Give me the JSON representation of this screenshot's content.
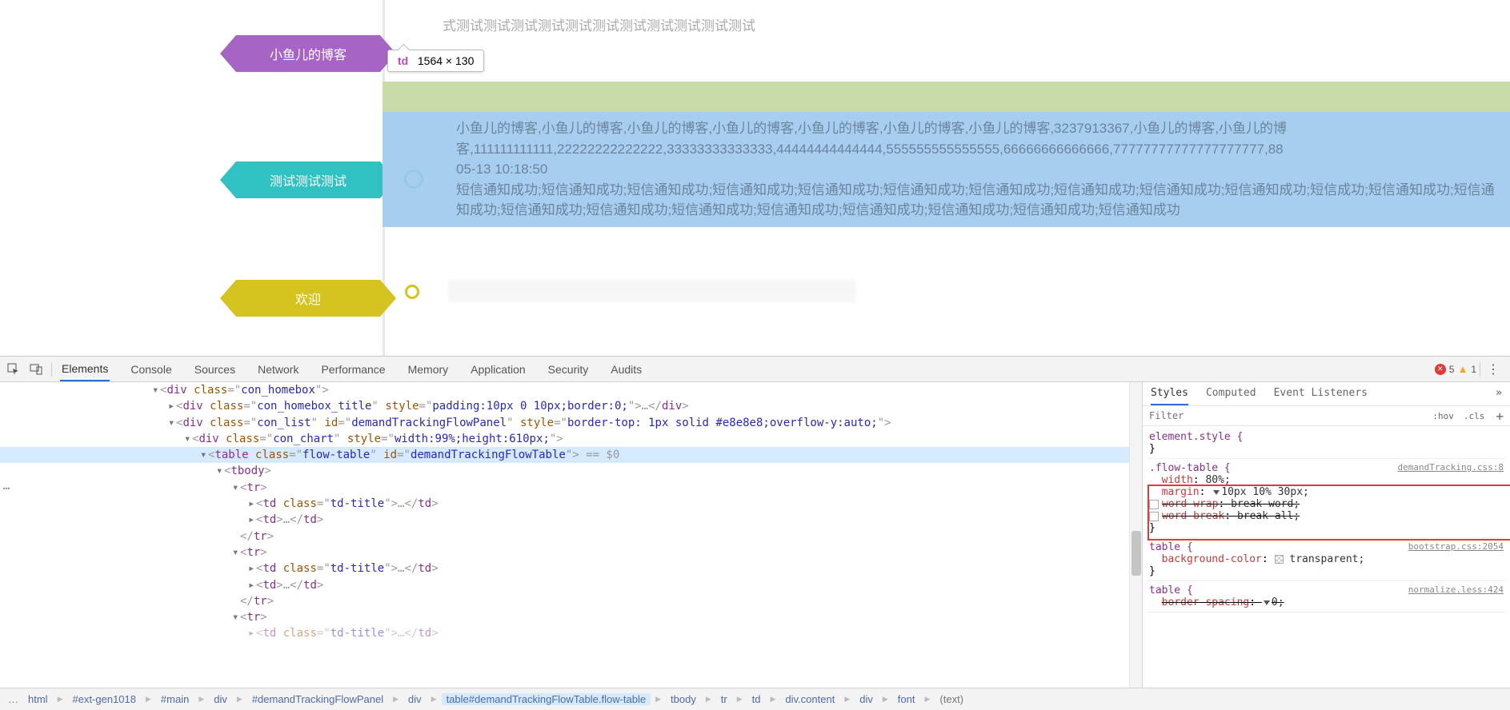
{
  "page": {
    "hex_purple_label": "小鱼儿的博客",
    "hex_teal_label": "测试测试测试",
    "hex_yellow_label": "欢迎",
    "dim_tooltip": {
      "tag": "td",
      "size": "1564 × 130"
    },
    "row1_text": "式测试测试测试测试测试测试测试测试测试测试测试",
    "blue_text_1": "小鱼儿的博客,小鱼儿的博客,小鱼儿的博客,小鱼儿的博客,小鱼儿的博客,小鱼儿的博客,小鱼儿的博客,3237913367,小鱼儿的博客,小鱼儿的博客,111111111111,22222222222222,33333333333333,44444444444444,555555555555555,66666666666666,77777777777777777777,88",
    "blue_text_2": "05-13 10:18:50",
    "blue_text_3": "短信通知成功;短信通知成功;短信通知成功;短信通知成功;短信通知成功;短信通知成功;短信通知成功;短信通知成功;短信通知成功;短信通知成功;短信成功;短信通知成功;短信通知成功;短信通知成功;短信通知成功;短信通知成功;短信通知成功;短信通知成功;短信通知成功;短信通知成功;短信通知成功"
  },
  "devtools": {
    "tabs": [
      "Elements",
      "Console",
      "Sources",
      "Network",
      "Performance",
      "Memory",
      "Application",
      "Security",
      "Audits"
    ],
    "active_tab": "Elements",
    "error_count": "5",
    "warn_count": "1",
    "dom": {
      "l0": "<div class=\"con_homebox\">",
      "l1a": "<div class=\"con_homebox_title\" style=\"padding:10px 0 10px;border:0;\">…</div>",
      "l1b": "<div class=\"con_list\" id=\"demandTrackingFlowPanel\" style=\"border-top: 1px solid #e8e8e8;overflow-y:auto;\">",
      "l2": "<div class=\"con_chart\" style=\"width:99%;height:610px;\">",
      "l3": "<table class=\"flow-table\" id=\"demandTrackingFlowTable\"> == $0",
      "l4": "<tbody>",
      "l5a": "<tr>",
      "l6a": "<td class=\"td-title\">…</td>",
      "l6b": "<td>…</td>",
      "l5ac": "</tr>",
      "l5b": "<tr>",
      "l6c": "<td class=\"td-title\">…</td>",
      "l6d": "<td>…</td>",
      "l5bc": "</tr>",
      "l5c": "<tr>",
      "l6e": "<td class=\"td-title\">…</td>"
    },
    "styles_panel": {
      "tabs": [
        "Styles",
        "Computed",
        "Event Listeners"
      ],
      "filter_placeholder": "Filter",
      "hov": ":hov",
      "cls": ".cls",
      "rules": {
        "r0_sel": "element.style {",
        "r0_close": "}",
        "r1_sel": ".flow-table {",
        "r1_src": "demandTracking.css:8",
        "r1_p1": {
          "prop": "width",
          "val": "80%;"
        },
        "r1_p2": {
          "prop": "margin",
          "val": "10px 10% 30px;"
        },
        "r1_p3": {
          "prop": "word-wrap",
          "val": "break-word;"
        },
        "r1_p4": {
          "prop": "word-break",
          "val": "break-all;"
        },
        "r1_close": "}",
        "r2_sel": "table {",
        "r2_src": "bootstrap.css:2054",
        "r2_p1": {
          "prop": "background-color",
          "val": "transparent;"
        },
        "r2_close": "}",
        "r3_sel": "table {",
        "r3_src": "normalize.less:424",
        "r3_p1": {
          "prop": "border-spacing",
          "val": "0;"
        }
      }
    },
    "breadcrumb": [
      "html",
      "#ext-gen1018",
      "#main",
      "div",
      "#demandTrackingFlowPanel",
      "div",
      "table#demandTrackingFlowTable.flow-table",
      "tbody",
      "tr",
      "td",
      "div.content",
      "div",
      "font",
      "(text)"
    ],
    "breadcrumb_selected_index": 6
  }
}
